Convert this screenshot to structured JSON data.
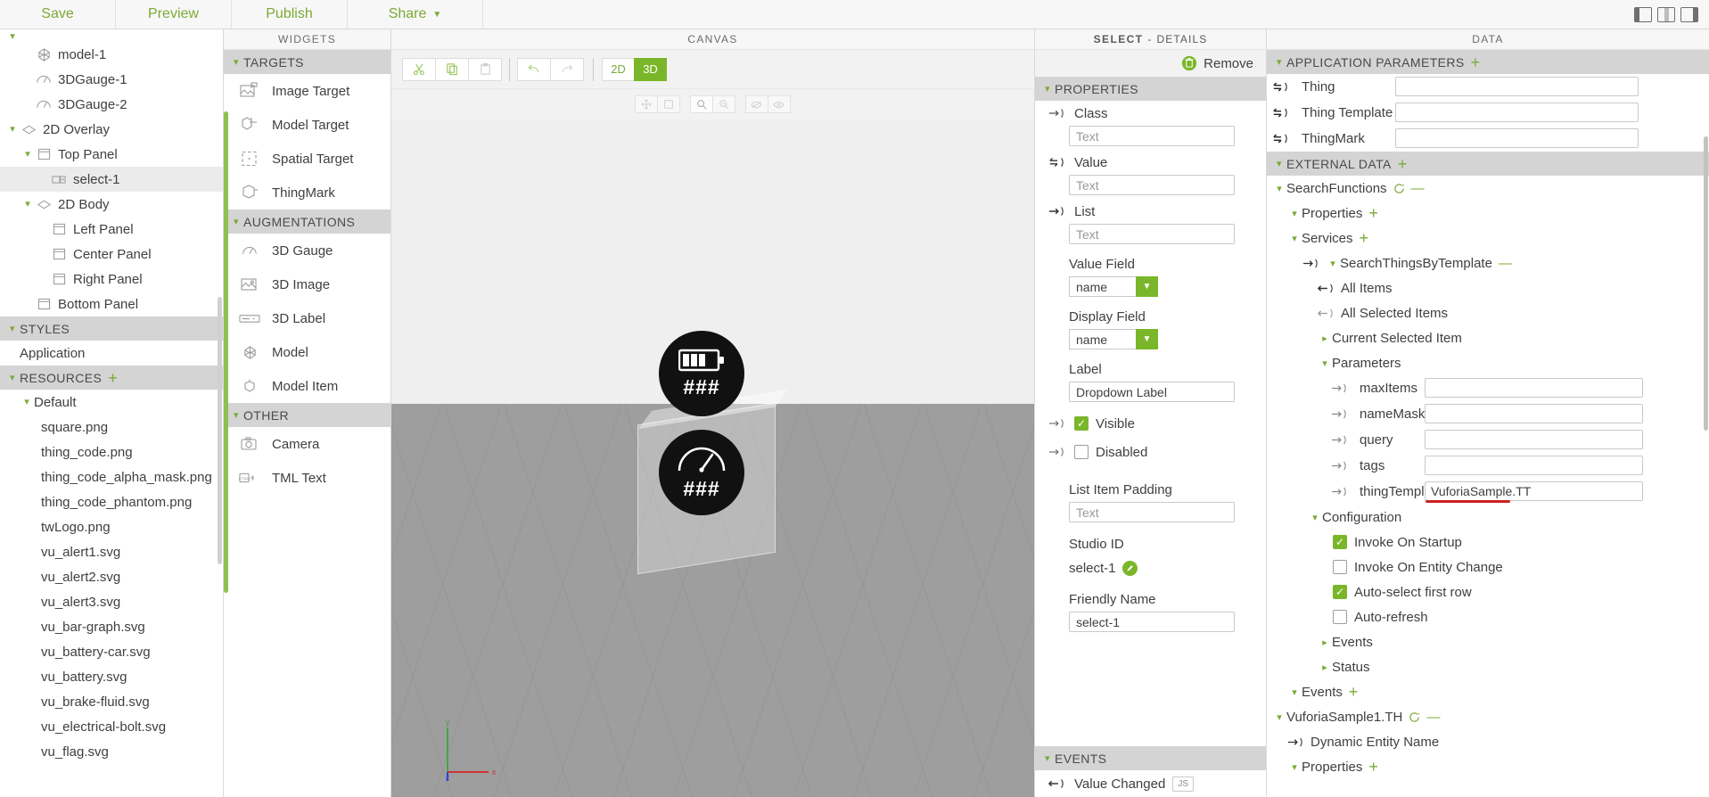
{
  "topbar": {
    "buttons": [
      {
        "label": "Save",
        "caret": false
      },
      {
        "label": "Preview",
        "caret": false
      },
      {
        "label": "Publish",
        "caret": false
      },
      {
        "label": "Share",
        "caret": true
      }
    ],
    "layout_icons": [
      "panel-left-icon",
      "panel-center-icon",
      "panel-right-icon"
    ]
  },
  "tree": {
    "items": [
      {
        "label": "model-1",
        "depth": 2,
        "chev": "",
        "icon": "model-icon",
        "selected": false
      },
      {
        "label": "3DGauge-1",
        "depth": 2,
        "chev": "",
        "icon": "gauge-icon",
        "selected": false
      },
      {
        "label": "3DGauge-2",
        "depth": 2,
        "chev": "",
        "icon": "gauge-icon",
        "selected": false
      },
      {
        "label": "2D Overlay",
        "depth": 1,
        "chev": "down",
        "icon": "layer-icon",
        "selected": false
      },
      {
        "label": "Top Panel",
        "depth": 2,
        "chev": "down",
        "icon": "panel-icon",
        "selected": false
      },
      {
        "label": "select-1",
        "depth": 3,
        "chev": "",
        "icon": "select-widget-icon",
        "selected": true
      },
      {
        "label": "2D Body",
        "depth": 2,
        "chev": "down",
        "icon": "layer-icon",
        "selected": false
      },
      {
        "label": "Left Panel",
        "depth": 3,
        "chev": "",
        "icon": "panel-icon",
        "selected": false
      },
      {
        "label": "Center Panel",
        "depth": 3,
        "chev": "",
        "icon": "panel-icon",
        "selected": false
      },
      {
        "label": "Right Panel",
        "depth": 3,
        "chev": "",
        "icon": "panel-icon",
        "selected": false
      },
      {
        "label": "Bottom Panel",
        "depth": 2,
        "chev": "",
        "icon": "panel-icon",
        "selected": false
      }
    ],
    "styles_header": "STYLES",
    "styles_item": "Application",
    "resources_header": "RESOURCES",
    "resources_default": "Default",
    "resources": [
      "square.png",
      "thing_code.png",
      "thing_code_alpha_mask.png",
      "thing_code_phantom.png",
      "twLogo.png",
      "vu_alert1.svg",
      "vu_alert2.svg",
      "vu_alert3.svg",
      "vu_bar-graph.svg",
      "vu_battery-car.svg",
      "vu_battery.svg",
      "vu_brake-fluid.svg",
      "vu_electrical-bolt.svg",
      "vu_flag.svg"
    ]
  },
  "widgets": {
    "title": "WIDGETS",
    "groups": [
      {
        "header": "TARGETS",
        "items": [
          {
            "label": "Image Target",
            "icon": "image-target-icon"
          },
          {
            "label": "Model Target",
            "icon": "model-target-icon"
          },
          {
            "label": "Spatial Target",
            "icon": "spatial-target-icon"
          },
          {
            "label": "ThingMark",
            "icon": "thingmark-icon"
          }
        ]
      },
      {
        "header": "AUGMENTATIONS",
        "items": [
          {
            "label": "3D Gauge",
            "icon": "gauge-icon"
          },
          {
            "label": "3D Image",
            "icon": "image-icon"
          },
          {
            "label": "3D Label",
            "icon": "label-icon"
          },
          {
            "label": "Model",
            "icon": "model-icon"
          },
          {
            "label": "Model Item",
            "icon": "model-item-icon"
          }
        ]
      },
      {
        "header": "OTHER",
        "items": [
          {
            "label": "Camera",
            "icon": "camera-icon"
          },
          {
            "label": "TML Text",
            "icon": "tml-text-icon"
          }
        ]
      }
    ]
  },
  "canvas": {
    "title": "CANVAS",
    "toolbar": {
      "cut": "cut-icon",
      "copy": "copy-icon",
      "paste": "paste-icon",
      "undo": "undo-icon",
      "redo": "redo-icon",
      "mode_2d": "2D",
      "mode_3d": "3D",
      "active_mode": "3D"
    },
    "subtoolbar": [
      "move-icon",
      "scale-icon",
      "zoom-fit-icon",
      "zoom-selection-icon",
      "hide-icon",
      "show-icon"
    ],
    "widgets_on_stage": [
      {
        "name": "3DGauge-1",
        "type": "battery-gauge",
        "value_text": "###"
      },
      {
        "name": "3DGauge-2",
        "type": "dial-gauge",
        "value_text": "###"
      }
    ],
    "axis_labels": {
      "x": "x",
      "y": "y",
      "z": "z"
    }
  },
  "details": {
    "title_bold": "SELECT",
    "title_sep": "-",
    "title_light": "DETAILS",
    "remove_label": "Remove",
    "properties_header": "PROPERTIES",
    "fields": [
      {
        "label": "Class",
        "bind_icon": "bind-out-icon",
        "type": "text",
        "value": "",
        "placeholder": "Text"
      },
      {
        "label": "Value",
        "bind_icon": "bind-two-way-icon",
        "type": "text",
        "value": "",
        "placeholder": "Text"
      },
      {
        "label": "List",
        "bind_icon": "bind-out-icon",
        "type": "text",
        "value": "",
        "placeholder": "Text"
      }
    ],
    "value_field": {
      "label": "Value Field",
      "value": "name"
    },
    "display_field": {
      "label": "Display Field",
      "value": "name"
    },
    "label_field": {
      "label": "Label",
      "value": "Dropdown Label"
    },
    "visible": {
      "label": "Visible",
      "checked": true,
      "bind_icon": "bind-out-icon"
    },
    "disabled": {
      "label": "Disabled",
      "checked": false,
      "bind_icon": "bind-out-icon"
    },
    "list_item_padding": {
      "label": "List Item Padding",
      "value": "",
      "placeholder": "Text"
    },
    "studio_id": {
      "label": "Studio ID",
      "value": "select-1",
      "edit_icon": "pencil-icon"
    },
    "friendly_name": {
      "label": "Friendly Name",
      "value": "select-1"
    },
    "events_header": "EVENTS",
    "events": [
      {
        "label": "Value Changed",
        "badge": "JS",
        "icon": "bind-in-icon"
      }
    ]
  },
  "data": {
    "title": "DATA",
    "app_params_header": "APPLICATION PARAMETERS",
    "app_params": [
      {
        "label": "Thing",
        "value": "",
        "icon": "bind-two-way-icon"
      },
      {
        "label": "Thing Template",
        "value": "",
        "icon": "bind-two-way-icon"
      },
      {
        "label": "ThingMark",
        "value": "",
        "icon": "bind-two-way-icon"
      }
    ],
    "external_data_header": "EXTERNAL DATA",
    "entities": [
      {
        "name": "SearchFunctions",
        "chev": "down",
        "has_refresh": true,
        "has_dash": true
      }
    ],
    "tree_rows": [
      {
        "label": "Properties",
        "depth": 2,
        "chev": "down",
        "plus": true
      },
      {
        "label": "Services",
        "depth": 2,
        "chev": "down",
        "plus": true
      },
      {
        "label": "SearchThingsByTemplate",
        "depth": 3,
        "chev": "down",
        "icon": "bind-out-icon",
        "dash": true
      },
      {
        "label": "All Items",
        "depth": 4,
        "icon": "bind-in-icon"
      },
      {
        "label": "All Selected Items",
        "depth": 4,
        "icon": "bind-in-icon-grey"
      },
      {
        "label": "Current Selected Item",
        "depth": 4,
        "chev": "right"
      },
      {
        "label": "Parameters",
        "depth": 4,
        "chev": "down"
      }
    ],
    "parameters": [
      {
        "label": "maxItems",
        "value": "",
        "underlined": false
      },
      {
        "label": "nameMask",
        "value": "",
        "underlined": false
      },
      {
        "label": "query",
        "value": "",
        "underlined": false
      },
      {
        "label": "tags",
        "value": "",
        "underlined": false
      },
      {
        "label": "thingTemplate",
        "value": "VuforiaSample.TT",
        "underlined": true
      }
    ],
    "configuration_label": "Configuration",
    "configuration": [
      {
        "label": "Invoke On Startup",
        "checked": true
      },
      {
        "label": "Invoke On Entity Change",
        "checked": false
      },
      {
        "label": "Auto-select first row",
        "checked": true
      },
      {
        "label": "Auto-refresh",
        "checked": false
      }
    ],
    "service_tail": [
      {
        "label": "Events",
        "depth": 4,
        "chev": "right"
      },
      {
        "label": "Status",
        "depth": 4,
        "chev": "right"
      }
    ],
    "entity_tail": [
      {
        "label": "Events",
        "depth": 2,
        "chev": "down",
        "plus": true
      }
    ],
    "entity2": {
      "name": "VuforiaSample1.TH",
      "chev": "down",
      "has_refresh": true,
      "has_dash": true,
      "rows": [
        {
          "label": "Dynamic Entity Name",
          "depth": 2,
          "icon": "bind-out-icon"
        },
        {
          "label": "Properties",
          "depth": 2,
          "chev": "down",
          "plus": true
        }
      ]
    }
  },
  "colors": {
    "accent_green": "#7ab629",
    "label_green": "#7ba936",
    "header_grey": "#d4d4d4",
    "selection_grey": "#ebebeb",
    "annotation_red": "#cc2222"
  }
}
